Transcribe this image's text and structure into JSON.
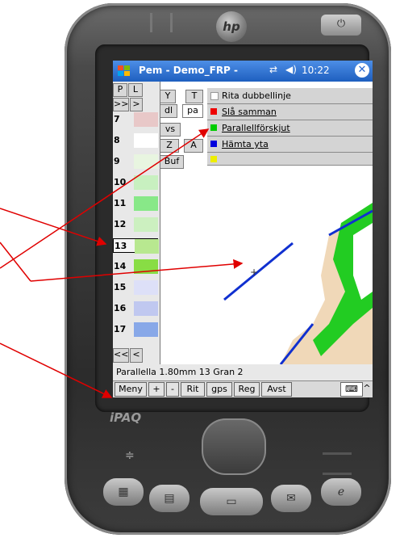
{
  "titlebar": {
    "title": "Pem - Demo_FRP -",
    "time": "10:22",
    "connectivity_icon": "connectivity-icon",
    "volume_icon": "volume-icon",
    "close_icon": "close-icon"
  },
  "left_panel": {
    "top_buttons": [
      "P",
      "L",
      "Y",
      "T"
    ],
    "second_row": [
      ">>",
      ">",
      "dl",
      "pa"
    ],
    "side_buttons": [
      "vs",
      "Z",
      "A",
      "Buf"
    ],
    "rows": [
      {
        "num": "7",
        "color": "#e8c8c8"
      },
      {
        "num": "8",
        "color": "#ffffff"
      },
      {
        "num": "9",
        "color": "#e8f5e0"
      },
      {
        "num": "10",
        "color": "#c8f0c0"
      },
      {
        "num": "11",
        "color": "#88e888"
      },
      {
        "num": "12",
        "color": "#ccf0c0"
      },
      {
        "num": "13",
        "color": "#b8e890"
      },
      {
        "num": "14",
        "color": "#88dd44"
      },
      {
        "num": "15",
        "color": "#dde0f8"
      },
      {
        "num": "16",
        "color": "#c0c8f0"
      },
      {
        "num": "17",
        "color": "#88a8e8"
      }
    ],
    "bottom_buttons": [
      "<<",
      "<"
    ]
  },
  "menu": {
    "items": [
      {
        "label": "Rita dubbellinje",
        "color": "#ffffff"
      },
      {
        "label": "Slå samman",
        "color": "#ee0000"
      },
      {
        "label": "Parallellförskjut",
        "color": "#00cc00"
      },
      {
        "label": "Hämta yta",
        "color": "#0000dd"
      },
      {
        "label": "",
        "color": "#eeee00"
      }
    ]
  },
  "status": {
    "text": "Parallella 1.80mm 13 Gran 2"
  },
  "command_bar": {
    "items": [
      "Meny",
      "+",
      "-",
      "Rit",
      "gps",
      "Reg",
      "Avst"
    ],
    "keyboard_icon": "keyboard-icon"
  },
  "device": {
    "brand_logo": "hp",
    "model": "iPAQ"
  },
  "colors": {
    "title_blue": "#2867cf",
    "annotation_red": "#e00000",
    "line_blue": "#1030d0"
  }
}
